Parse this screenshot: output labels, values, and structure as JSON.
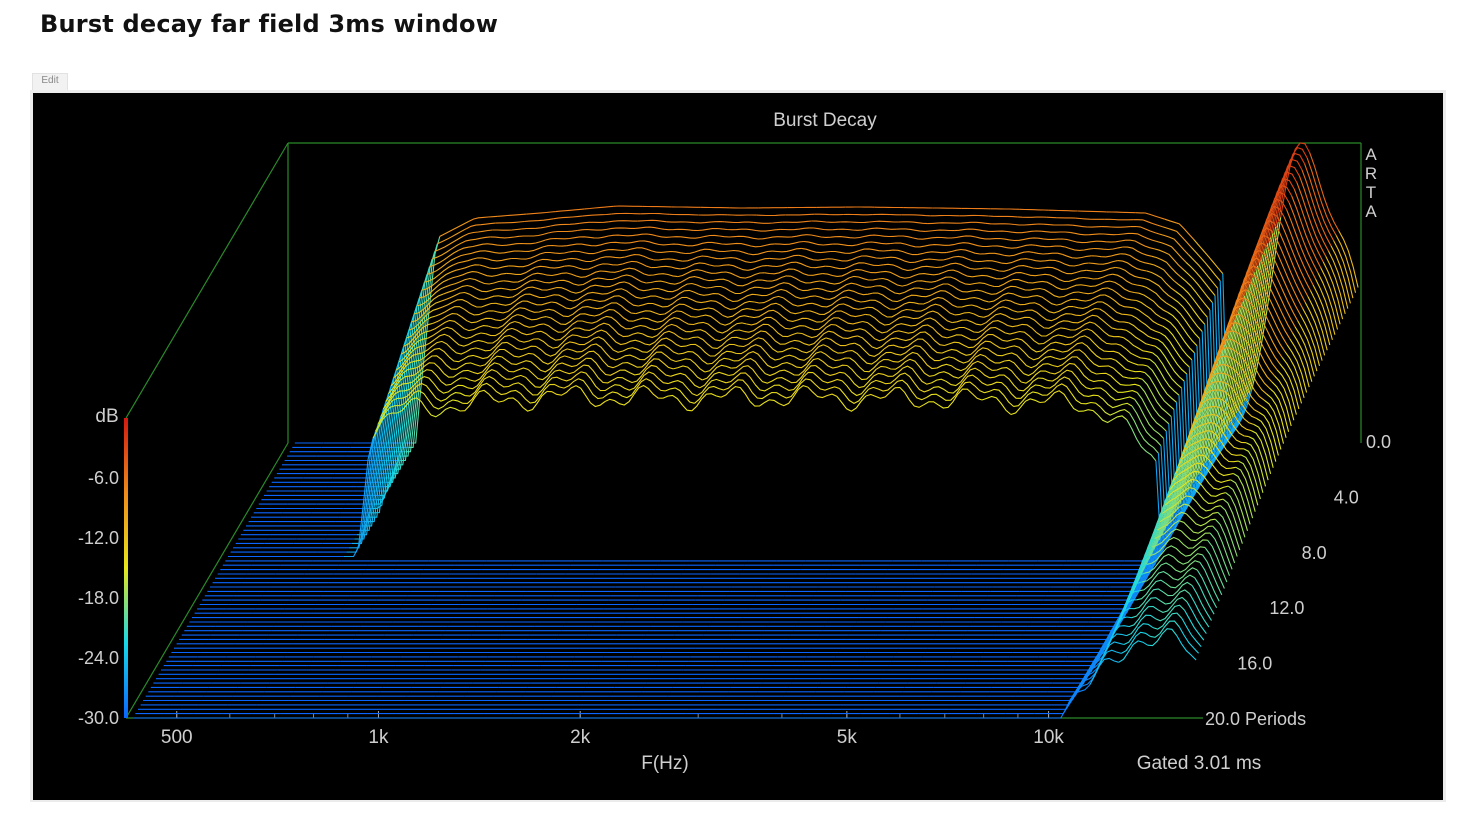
{
  "page": {
    "title": "Burst decay far field 3ms window",
    "edit_label": "Edit"
  },
  "chart_data": {
    "type": "waterfall",
    "title": "Burst Decay",
    "watermark": "ARTA",
    "xlabel": "F(Hz)",
    "x_scale": "log",
    "xlim": [
      420,
      17000
    ],
    "x_ticks": [
      {
        "value": 500,
        "label": "500"
      },
      {
        "value": 1000,
        "label": "1k"
      },
      {
        "value": 2000,
        "label": "2k"
      },
      {
        "value": 5000,
        "label": "5k"
      },
      {
        "value": 10000,
        "label": "10k"
      }
    ],
    "ylabel": "dB",
    "ylim": [
      -30,
      0
    ],
    "y_ticks": [
      "-6.0",
      "-12.0",
      "-18.0",
      "-24.0",
      "-30.0"
    ],
    "z_ticks": [
      "0.0",
      "4.0",
      "8.0",
      "12.0",
      "16.0",
      "20.0 Periods"
    ],
    "zlim": [
      0,
      20
    ],
    "zlabel": "Periods",
    "footer": "Gated 3.01 ms",
    "colorscale": [
      "#0a66ff",
      "#17d8e8",
      "#e6e61a",
      "#f08a1a",
      "#d11a10"
    ],
    "front_slice": [
      {
        "f": 650,
        "db": -30
      },
      {
        "f": 700,
        "db": -9.5
      },
      {
        "f": 800,
        "db": -7.5
      },
      {
        "f": 1000,
        "db": -7
      },
      {
        "f": 1300,
        "db": -6.3
      },
      {
        "f": 2000,
        "db": -6.5
      },
      {
        "f": 3000,
        "db": -6.4
      },
      {
        "f": 5000,
        "db": -6.6
      },
      {
        "f": 8000,
        "db": -7
      },
      {
        "f": 11000,
        "db": -10
      },
      {
        "f": 14000,
        "db": -1
      },
      {
        "f": 17000,
        "db": -11
      }
    ]
  }
}
